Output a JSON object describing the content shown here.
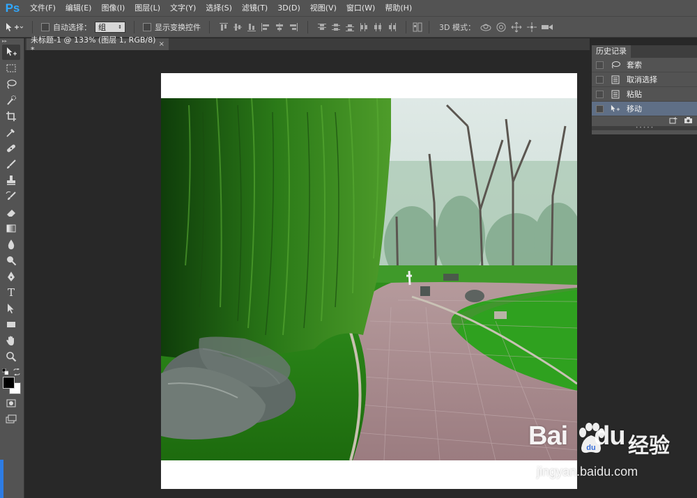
{
  "app": {
    "logo": "Ps"
  },
  "menubar": {
    "items": [
      {
        "label": "文件(F)"
      },
      {
        "label": "编辑(E)"
      },
      {
        "label": "图像(I)"
      },
      {
        "label": "图层(L)"
      },
      {
        "label": "文字(Y)"
      },
      {
        "label": "选择(S)"
      },
      {
        "label": "滤镜(T)"
      },
      {
        "label": "3D(D)"
      },
      {
        "label": "视图(V)"
      },
      {
        "label": "窗口(W)"
      },
      {
        "label": "帮助(H)"
      }
    ]
  },
  "options": {
    "tool_icon": "move-tool-icon",
    "auto_select_label": "自动选择：",
    "auto_select_value": "组",
    "show_transform_label": "显示变换控件",
    "mode3d_label": "3D 模式："
  },
  "document": {
    "tab_title": "未标题-1 @ 133% (图层 1, RGB/8) *",
    "close_glyph": "×"
  },
  "history": {
    "panel_title": "历史记录",
    "items": [
      {
        "label": "套索",
        "icon": "lasso-icon"
      },
      {
        "label": "取消选择",
        "icon": "document-icon"
      },
      {
        "label": "粘贴",
        "icon": "document-icon"
      },
      {
        "label": "移动",
        "icon": "move-tool-icon",
        "active": true
      }
    ]
  },
  "toolbar": {
    "type_tool_glyph": "T"
  },
  "watermark": {
    "logo_text_left": "Bai",
    "logo_text_right": "du",
    "brand": "经验",
    "url": "jingyan.baidu.com"
  },
  "colors": {
    "ui_dark": "#282828",
    "ui_panel": "#535353",
    "history_active": "#5f6f86",
    "ps_blue": "#31a8ff",
    "foreground": "#000000",
    "background": "#ffffff"
  }
}
